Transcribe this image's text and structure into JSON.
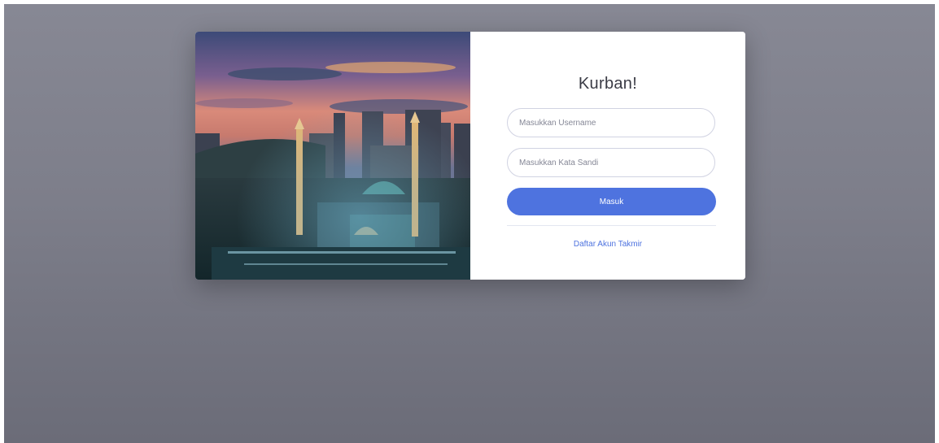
{
  "login": {
    "title": "Kurban!",
    "username_placeholder": "Masukkan Username",
    "password_placeholder": "Masukkan Kata Sandi",
    "submit_label": "Masuk",
    "register_link": "Daftar Akun Takmir"
  },
  "colors": {
    "primary": "#4e73df",
    "background": "#7d7e8a",
    "card": "#ffffff"
  },
  "image": {
    "subject": "mosque at dusk with city skyline"
  }
}
